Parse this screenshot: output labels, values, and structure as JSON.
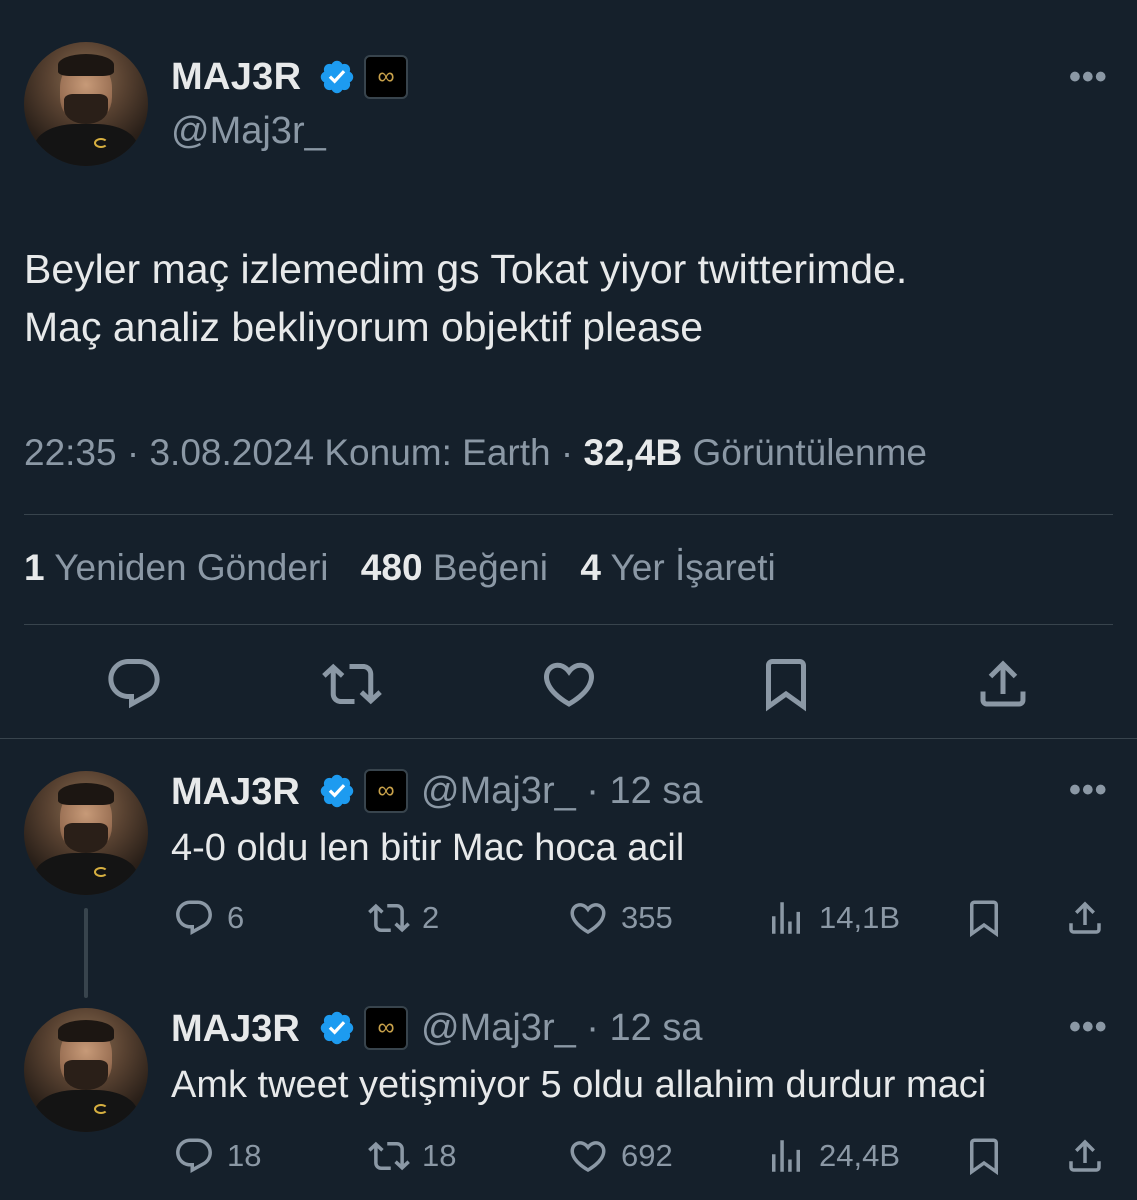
{
  "main_tweet": {
    "name": "MAJ3R",
    "handle": "@Maj3r_",
    "text_line1": "Beyler maç izlemedim gs Tokat yiyor twitterimde.",
    "text_line2": "Maç analiz bekliyorum objektif please",
    "time": "22:35",
    "date": "3.08.2024",
    "location": "Konum: Earth",
    "views_count": "32,4B",
    "views_label": "Görüntülenme",
    "reposts_count": "1",
    "reposts_label": "Yeniden Gönderi",
    "likes_count": "480",
    "likes_label": "Beğeni",
    "bookmarks_count": "4",
    "bookmarks_label": "Yer İşareti"
  },
  "replies": [
    {
      "name": "MAJ3R",
      "handle": "@Maj3r_",
      "time": "· 12 sa",
      "text": "4-0 oldu len bitir Mac hoca acil",
      "replies": "6",
      "reposts": "2",
      "likes": "355",
      "views": "14,1B"
    },
    {
      "name": "MAJ3R",
      "handle": "@Maj3r_",
      "time": "· 12 sa",
      "text": "Amk tweet yetişmiyor 5 oldu allahim durdur maci",
      "replies": "18",
      "reposts": "18",
      "likes": "692",
      "views": "24,4B"
    }
  ],
  "icons": {
    "verified": "verified-badge-icon",
    "affiliate": "infinity-icon",
    "more": "more-icon",
    "reply": "reply-icon",
    "repost": "repost-icon",
    "like": "heart-icon",
    "bookmark": "bookmark-icon",
    "share": "share-icon",
    "views": "views-icon"
  },
  "colors": {
    "background": "#15202b",
    "text": "#e7e9ea",
    "secondary": "#8b98a5",
    "verified": "#1d9bf0",
    "divider": "#38444d"
  }
}
